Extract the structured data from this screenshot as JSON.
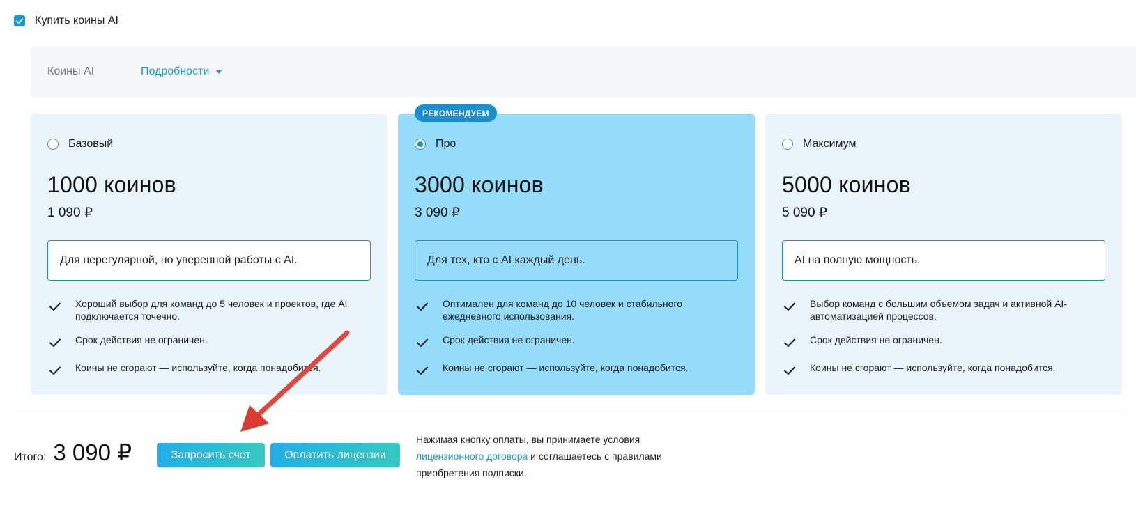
{
  "top_checkbox": {
    "label": "Купить коины AI",
    "checked": true
  },
  "details_bar": {
    "title": "Коины AI",
    "link_label": "Подробности"
  },
  "badge": "РЕКОМЕНДУЕМ",
  "plans": [
    {
      "name": "Базовый",
      "selected": false,
      "coins": "1000 коинов",
      "price": "1 090 ₽",
      "description": "Для нерегулярной, но уверенной работы с AI.",
      "features": [
        "Хороший выбор для команд до 5 человек и проектов, где AI подключается точечно.",
        "Срок действия не ограничен.",
        "Коины не сгорают — используйте, когда понадобится."
      ]
    },
    {
      "name": "Про",
      "selected": true,
      "coins": "3000 коинов",
      "price": "3 090 ₽",
      "description": "Для тех, кто с AI каждый день.",
      "features": [
        "Оптимален для команд до 10 человек и стабильного ежедневного использования.",
        "Срок действия не ограничен.",
        "Коины не сгорают — используйте, когда понадобится."
      ]
    },
    {
      "name": "Максимум",
      "selected": false,
      "coins": "5000 коинов",
      "price": "5 090 ₽",
      "description": "AI на полную мощность.",
      "features": [
        "Выбор команд с большим объемом задач и активной AI-автоматизацией процессов.",
        "Срок действия не ограничен.",
        "Коины не сгорают — используйте, когда понадобится."
      ]
    }
  ],
  "footer": {
    "total_label": "Итого:",
    "total_value": "3 090 ₽",
    "invoice_button": "Запросить счет",
    "pay_button": "Оплатить лицензии",
    "legal_before": "Нажимая кнопку оплаты, вы принимаете условия ",
    "legal_link": "лицензионного договора",
    "legal_after": " и соглашаетесь с правилами приобретения подписки."
  },
  "colors": {
    "accent": "#1a96d8",
    "card_bg": "#e9f5fb",
    "card_selected_bg": "#94dcfa",
    "annotation_arrow": "#e8443a"
  },
  "icons": [
    "checkbox-check-icon",
    "caret-down-icon",
    "radio-icon",
    "check-mark-icon",
    "annotation-arrow-icon"
  ]
}
